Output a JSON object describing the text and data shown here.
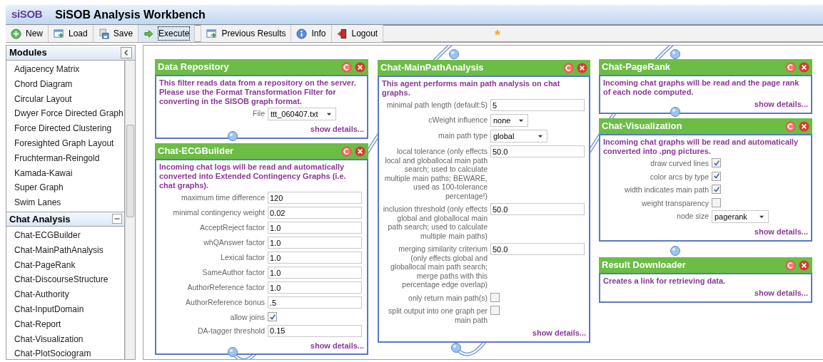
{
  "app": {
    "logo": "siSOB",
    "title": "SiSOB Analysis Workbench"
  },
  "toolbar": [
    {
      "label": "New",
      "selected": false
    },
    {
      "label": "Load",
      "selected": false
    },
    {
      "label": "Save",
      "selected": false
    },
    {
      "label": "Execute",
      "selected": true
    },
    {
      "label": "Previous Results",
      "selected": false
    },
    {
      "label": "Info",
      "selected": false
    },
    {
      "label": "Logout",
      "selected": false
    }
  ],
  "unsaved_marker": "*",
  "sidebar": {
    "groups": [
      {
        "title": "Modules",
        "items": [
          "Adjacency Matrix",
          "Chord Diagram",
          "Circular Layout",
          "Dwyer Force Directed Graph",
          "Force Directed Clustering",
          "Foresighted Graph Layout",
          "Fruchterman-Reingold",
          "Kamada-Kawai",
          "Super Graph",
          "Swim Lanes"
        ]
      },
      {
        "title": "Chat Analysis",
        "items": [
          "Chat-ECGBuilder",
          "Chat-MainPathAnalysis",
          "Chat-PageRank",
          "Chat-DiscourseStructure",
          "Chat-Authority",
          "Chat-InputDomain",
          "Chat-Report",
          "Chat-Visualization",
          "Chat-PlotSociogram"
        ]
      }
    ]
  },
  "canvas": {
    "modules": [
      {
        "title": "Data Repository",
        "description": "This filter reads data from a repository on the server. Please use the Format Transformation Filter for converting in the SISOB graph format.",
        "fields": [
          {
            "kind": "select",
            "label": "File",
            "value": "ttt_060407.txt"
          }
        ],
        "show_details": "show details..."
      },
      {
        "title": "Chat-ECGBuilder",
        "description": "Incoming chat logs will be read and automatically converted into Extended Contingency Graphs (i.e. chat graphs).",
        "fields": [
          {
            "kind": "text",
            "label": "maximum time difference",
            "value": "120"
          },
          {
            "kind": "text",
            "label": "minimal contingency weight",
            "value": "0.02"
          },
          {
            "kind": "text",
            "label": "AcceptReject factor",
            "value": "1.0"
          },
          {
            "kind": "text",
            "label": "whQAnswer factor",
            "value": "1.0"
          },
          {
            "kind": "text",
            "label": "Lexical factor",
            "value": "1.0"
          },
          {
            "kind": "text",
            "label": "SameAuthor factor",
            "value": "1.0"
          },
          {
            "kind": "text",
            "label": "AuthorReference factor",
            "value": "1.0"
          },
          {
            "kind": "text",
            "label": "AuthorReference bonus",
            "value": ".5"
          },
          {
            "kind": "checkbox",
            "label": "allow joins",
            "checked": true
          },
          {
            "kind": "text",
            "label": "DA-tagger threshold",
            "value": "0.15"
          }
        ],
        "show_details": "show details..."
      },
      {
        "title": "Chat-MainPathAnalysis",
        "description": "This agent performs main path analysis on chat graphs.",
        "fields": [
          {
            "kind": "text",
            "label": "minimal path length (default:5)",
            "value": "5"
          },
          {
            "kind": "select",
            "label": "cWeight influence",
            "value": "none"
          },
          {
            "kind": "select",
            "label": "main path type",
            "value": "global"
          },
          {
            "kind": "text",
            "label": "local tolerance (only effects local and globallocal main path search; used to calculate multiple main paths; BEWARE, used as 100-tolerance percentage!)",
            "value": "50.0"
          },
          {
            "kind": "text",
            "label": "inclusion threshold (only effects global and globallocal main path search; used to calculate multiple main paths)",
            "value": "50.0"
          },
          {
            "kind": "text",
            "label": "merging similarity criterium (only effects global and globallocal main path search; merge paths with this percentage edge overlap)",
            "value": "50.0"
          },
          {
            "kind": "checkbox",
            "label": "only return main path(s)",
            "checked": false
          },
          {
            "kind": "checkbox",
            "label": "split output into one graph per main path",
            "checked": false
          }
        ],
        "show_details": "show details..."
      },
      {
        "title": "Chat-PageRank",
        "description": "Incoming chat graphs will be read and the page rank of each node computed.",
        "show_details": "show details..."
      },
      {
        "title": "Chat-Visualization",
        "description": "Incoming chat graphs will be read and automatically converted into .png pictures.",
        "fields": [
          {
            "kind": "checkbox",
            "label": "draw curved lines",
            "checked": true
          },
          {
            "kind": "checkbox",
            "label": "color arcs by type",
            "checked": true
          },
          {
            "kind": "checkbox",
            "label": "width indicates main path",
            "checked": true
          },
          {
            "kind": "checkbox",
            "label": "weight transparency",
            "checked": false
          },
          {
            "kind": "select",
            "label": "node size",
            "value": "pagerank"
          }
        ],
        "show_details": "show details..."
      },
      {
        "title": "Result Downloader",
        "description": "Creates a link for retrieving data.",
        "show_details": "show details..."
      }
    ]
  }
}
